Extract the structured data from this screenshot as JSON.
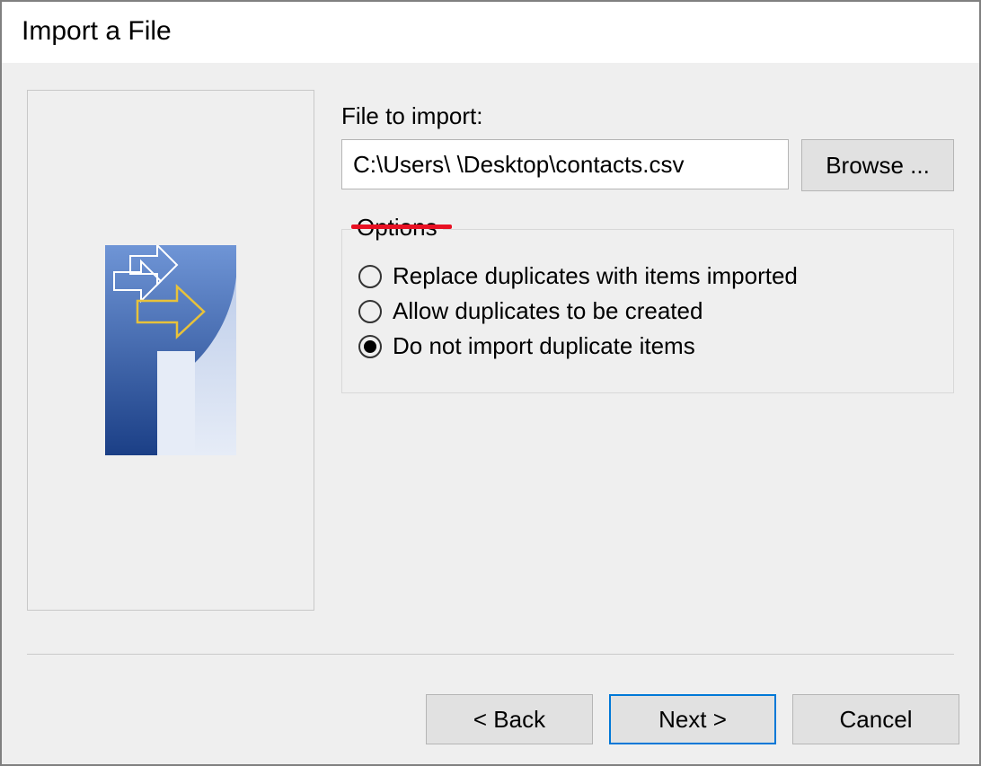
{
  "window": {
    "title": "Import a File"
  },
  "file": {
    "label": "File to import:",
    "path": "C:\\Users\\      \\Desktop\\contacts.csv",
    "browse_label": "Browse ..."
  },
  "options": {
    "legend": "Options",
    "selected_index": 2,
    "items": [
      {
        "label": "Replace duplicates with items imported"
      },
      {
        "label": "Allow duplicates to be created"
      },
      {
        "label": "Do not import duplicate items"
      }
    ]
  },
  "buttons": {
    "back": "< Back",
    "next": "Next >",
    "cancel": "Cancel"
  },
  "annotation": {
    "underline_color": "#e81123"
  }
}
